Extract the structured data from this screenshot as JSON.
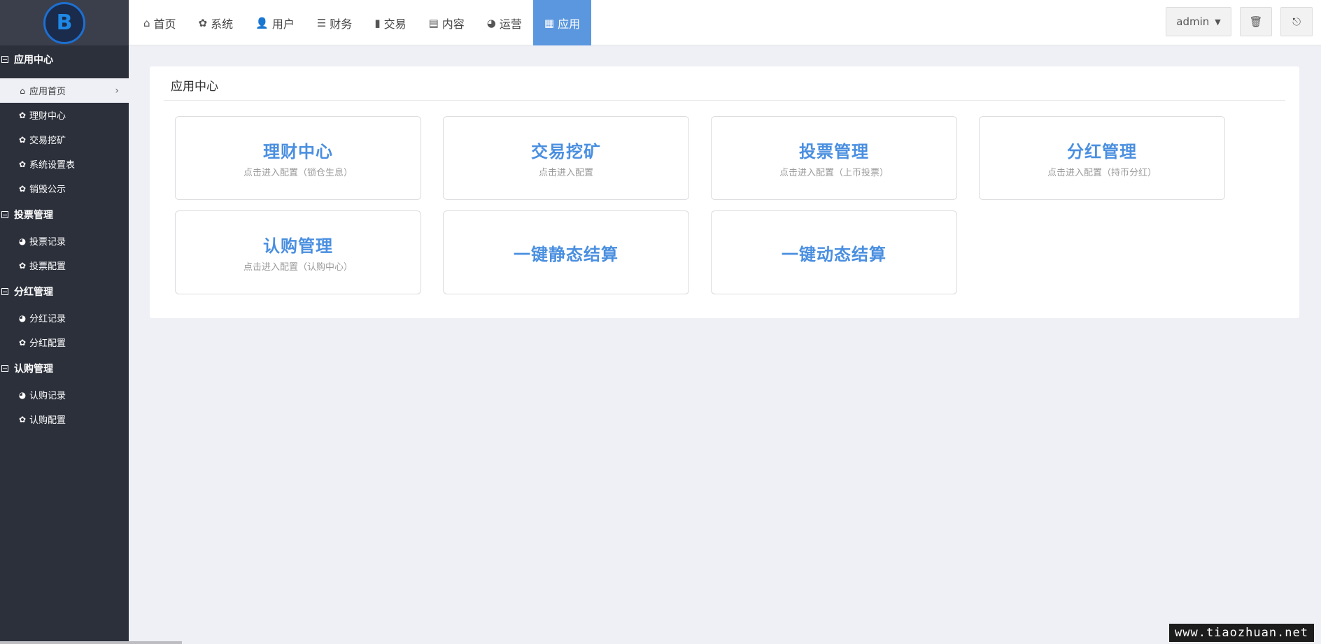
{
  "sidebar": {
    "logo_text": "B",
    "groups": [
      {
        "title": "应用中心",
        "items": [
          {
            "label": "应用首页",
            "icon": "⌂",
            "active": true
          },
          {
            "label": "理财中心",
            "icon": "✿"
          },
          {
            "label": "交易挖矿",
            "icon": "✿"
          },
          {
            "label": "系统设置表",
            "icon": "✿"
          },
          {
            "label": "销毁公示",
            "icon": "✿"
          }
        ]
      },
      {
        "title": "投票管理",
        "items": [
          {
            "label": "投票记录",
            "icon": "◕"
          },
          {
            "label": "投票配置",
            "icon": "✿"
          }
        ]
      },
      {
        "title": "分红管理",
        "items": [
          {
            "label": "分红记录",
            "icon": "◕"
          },
          {
            "label": "分红配置",
            "icon": "✿"
          }
        ]
      },
      {
        "title": "认购管理",
        "items": [
          {
            "label": "认购记录",
            "icon": "◕"
          },
          {
            "label": "认购配置",
            "icon": "✿"
          }
        ]
      }
    ]
  },
  "topnav": {
    "items": [
      {
        "label": "首页",
        "icon": "⌂"
      },
      {
        "label": "系统",
        "icon": "✿"
      },
      {
        "label": "用户",
        "icon": "👤"
      },
      {
        "label": "财务",
        "icon": "☰"
      },
      {
        "label": "交易",
        "icon": "▮"
      },
      {
        "label": "内容",
        "icon": "▤"
      },
      {
        "label": "运营",
        "icon": "◕"
      },
      {
        "label": "应用",
        "icon": "▦",
        "active": true
      }
    ],
    "admin_label": "admin",
    "trash_icon": "🗑",
    "logout_icon": "⎋"
  },
  "main": {
    "title": "应用中心",
    "cards": [
      {
        "title": "理财中心",
        "subtitle": "点击进入配置（锁仓生息）"
      },
      {
        "title": "交易挖矿",
        "subtitle": "点击进入配置"
      },
      {
        "title": "投票管理",
        "subtitle": "点击进入配置（上币投票）"
      },
      {
        "title": "分红管理",
        "subtitle": "点击进入配置（持币分红）"
      },
      {
        "title": "认购管理",
        "subtitle": "点击进入配置（认购中心）"
      },
      {
        "title": "一键静态结算",
        "subtitle": ""
      },
      {
        "title": "一键动态结算",
        "subtitle": ""
      }
    ]
  },
  "watermark": "www.tiaozhuan.net",
  "colors": {
    "sidebar_bg": "#2c303b",
    "accent": "#5b97de",
    "card_title": "#4a8fe0",
    "page_bg": "#eff0f5"
  }
}
